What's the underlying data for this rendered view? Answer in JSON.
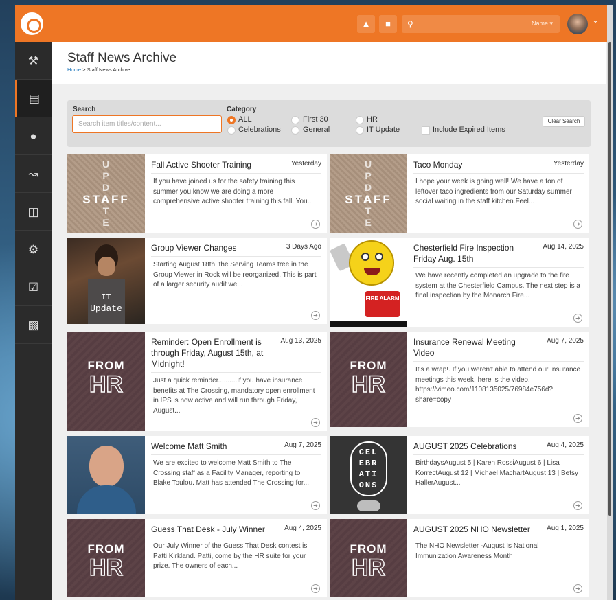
{
  "header": {
    "name_label": "Name ▾",
    "search_placeholder": "",
    "avatar_icon": "user-avatar"
  },
  "sidebar": {
    "items": [
      {
        "icon": "hammer"
      },
      {
        "icon": "book"
      },
      {
        "icon": "person"
      },
      {
        "icon": "chart"
      },
      {
        "icon": "money"
      },
      {
        "icon": "wrench"
      },
      {
        "icon": "checkbox"
      },
      {
        "icon": "briefcase"
      }
    ]
  },
  "page": {
    "title": "Staff News Archive",
    "breadcrumb_home": "Home",
    "breadcrumb_sep": ">",
    "breadcrumb_current": "Staff News Archive"
  },
  "filter": {
    "search_label": "Search",
    "search_placeholder": "Search item titles/content...",
    "category_label": "Category",
    "categories": [
      "ALL",
      "Celebrations",
      "First 30",
      "General",
      "HR",
      "IT Update"
    ],
    "selected": "ALL",
    "include_expired_label": "Include Expired Items",
    "clear_label": "Clear Search"
  },
  "thumb_text": {
    "staff_vertical": "UPDATE",
    "staff_word": "STAFF",
    "it_word": "IT",
    "update_word": "Update",
    "from": "FROM",
    "hr": "HR",
    "fire_sign": "FIRE ALARM",
    "cel_lines": [
      "CEL",
      "EBR",
      "ATI",
      "ONS"
    ]
  },
  "news": [
    {
      "title": "Fall Active Shooter Training",
      "date": "Yesterday",
      "desc": "If you have joined us for the safety training this summer you know we are doing a more comprehensive active shooter training this fall. You..."
    },
    {
      "title": "Taco Monday",
      "date": "Yesterday",
      "desc": "I hope your week is going well! We have a ton of leftover taco ingredients from our Saturday summer social waiting in the staff kitchen.Feel..."
    },
    {
      "title": "Group Viewer Changes",
      "date": "3 Days Ago",
      "desc": "Starting August 18th, the Serving Teams tree in the Group Viewer in Rock will be reorganized. This is part of a larger security audit we..."
    },
    {
      "title": "Chesterfield Fire Inspection Friday Aug. 15th",
      "date": "Aug 14, 2025",
      "desc": "We have recently completed an upgrade to the fire system at the Chesterfield Campus. The next step is a final inspection by the Monarch Fire..."
    },
    {
      "title": "Reminder: Open Enrollment is through Friday, August 15th, at Midnight!",
      "date": "Aug 13, 2025",
      "desc": "Just a quick reminder..........If you have insurance benefits at The Crossing, mandatory open enrollment in IPS is now active and will run through Friday, August..."
    },
    {
      "title": "Insurance Renewal Meeting Video",
      "date": "Aug 7, 2025",
      "desc": "It's a wrap!.  If you weren't able to attend our Insurance meetings this week, here is the video. https://vimeo.com/1108135025/76984e756d?share=copy"
    },
    {
      "title": "Welcome Matt Smith",
      "date": "Aug 7, 2025",
      "desc": "We are excited to welcome Matt Smith to The Crossing staff as a Facility Manager, reporting to Blake Toulou. Matt has attended The Crossing for..."
    },
    {
      "title": "AUGUST 2025 Celebrations",
      "date": "Aug 4, 2025",
      "desc": "BirthdaysAugust  5   |   Karen RossiAugust  6   |   Lisa KorrectAugust 12   |   Michael MachartAugust 13   |   Betsy HallerAugust..."
    },
    {
      "title": "Guess That Desk - July Winner",
      "date": "Aug 4, 2025",
      "desc": "Our July Winner of the Guess That Desk contest is Patti Kirkland.  Patti, come by the HR suite for your prize. The owners of each..."
    },
    {
      "title": "AUGUST 2025 NHO Newsletter",
      "date": "Aug 1, 2025",
      "desc": "The NHO Newsletter -August Is National Immunization Awareness Month"
    }
  ]
}
